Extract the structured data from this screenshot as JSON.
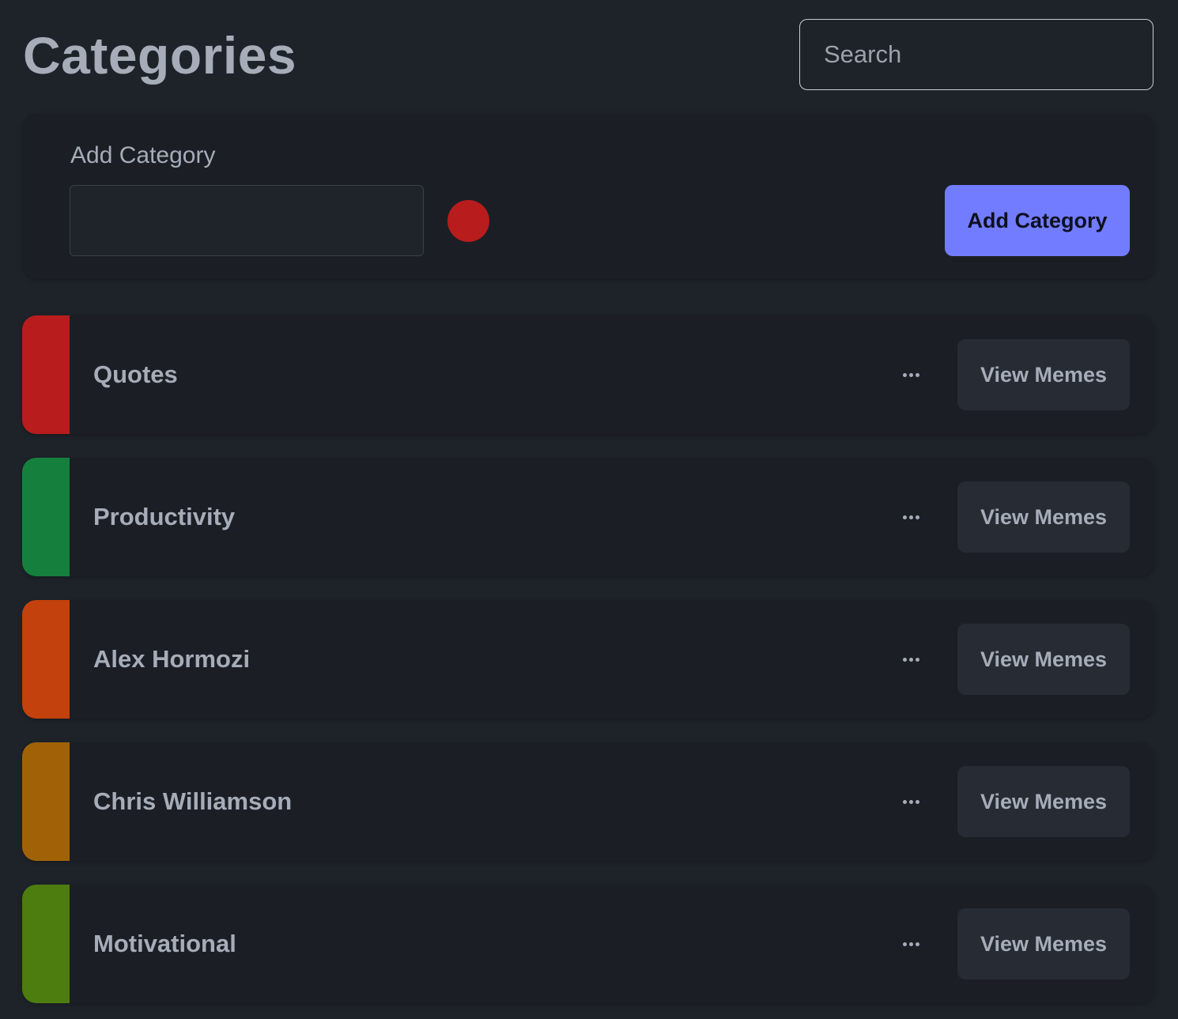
{
  "header": {
    "title": "Categories",
    "search_placeholder": "Search",
    "search_value": ""
  },
  "add_category": {
    "label": "Add Category",
    "input_value": "",
    "selected_color": "#b91c1c",
    "button_label": "Add Category",
    "button_color": "#727cff"
  },
  "categories": [
    {
      "name": "Quotes",
      "color": "#b91c1c",
      "more_icon": "more-horizontal-icon",
      "button_label": "View Memes"
    },
    {
      "name": "Productivity",
      "color": "#15803d",
      "more_icon": "more-horizontal-icon",
      "button_label": "View Memes"
    },
    {
      "name": "Alex Hormozi",
      "color": "#c2410c",
      "more_icon": "more-horizontal-icon",
      "button_label": "View Memes"
    },
    {
      "name": "Chris Williamson",
      "color": "#a16207",
      "more_icon": "more-horizontal-icon",
      "button_label": "View Memes"
    },
    {
      "name": "Motivational",
      "color": "#4d7c0f",
      "more_icon": "more-horizontal-icon",
      "button_label": "View Memes"
    }
  ]
}
